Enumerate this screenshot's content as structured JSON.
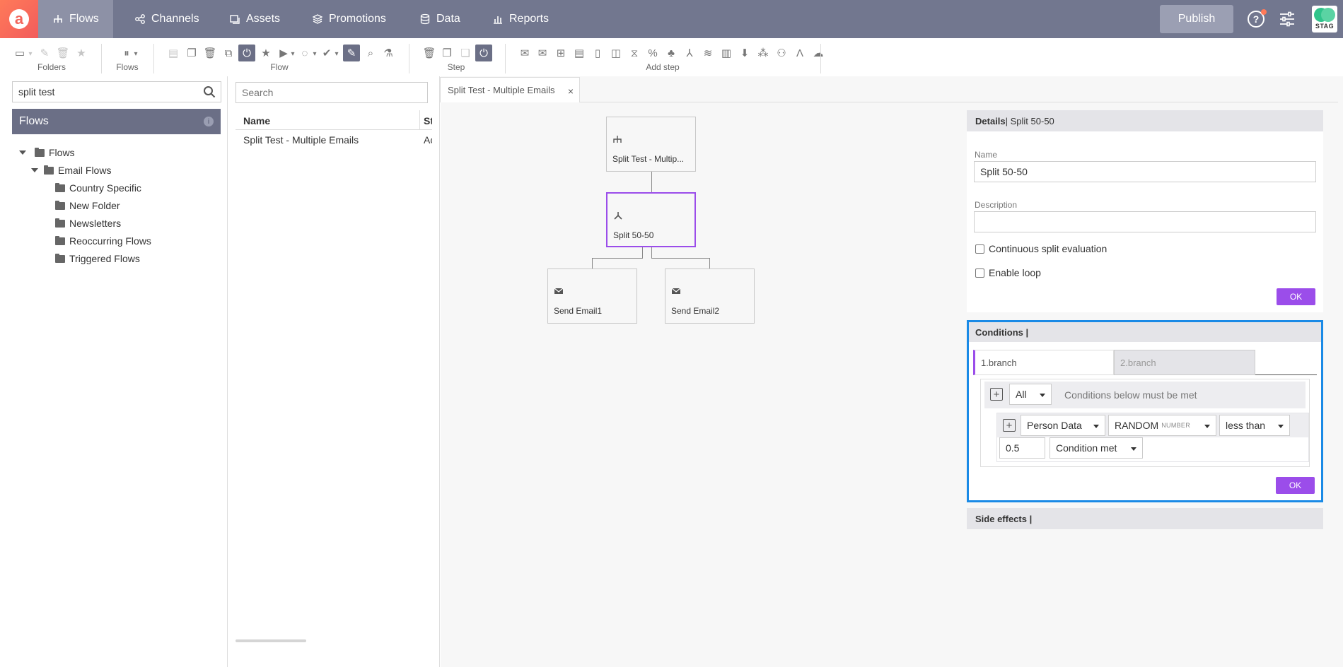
{
  "nav": {
    "logo": "a",
    "items": [
      {
        "label": "Flows",
        "icon": "flows-icon"
      },
      {
        "label": "Channels",
        "icon": "channels-icon"
      },
      {
        "label": "Assets",
        "icon": "assets-icon"
      },
      {
        "label": "Promotions",
        "icon": "promotions-icon"
      },
      {
        "label": "Data",
        "icon": "data-icon"
      },
      {
        "label": "Reports",
        "icon": "reports-icon"
      }
    ],
    "publish_label": "Publish",
    "help_label": "?",
    "env_label": "STAG"
  },
  "toolbar": {
    "groups": {
      "folders": "Folders",
      "flows": "Flows",
      "flow": "Flow",
      "step": "Step",
      "add_step": "Add step"
    }
  },
  "sidebar": {
    "search_value": "split test",
    "header": "Flows",
    "info": "i",
    "tree": [
      {
        "label": "Flows",
        "level": 0,
        "expanded": true
      },
      {
        "label": "Email Flows",
        "level": 1,
        "expanded": true
      },
      {
        "label": "Country Specific",
        "level": 2
      },
      {
        "label": "New Folder",
        "level": 2
      },
      {
        "label": "Newsletters",
        "level": 2
      },
      {
        "label": "Reoccurring Flows",
        "level": 2
      },
      {
        "label": "Triggered Flows",
        "level": 2
      }
    ]
  },
  "list": {
    "search_placeholder": "Search",
    "columns": [
      "Name",
      "Status"
    ],
    "rows": [
      {
        "name": "Split Test - Multiple Emails",
        "status": "Active"
      }
    ]
  },
  "canvas": {
    "tab_label": "Split Test - Multiple Emails",
    "tab_close": "×",
    "nodes": [
      {
        "label": "Split Test - Multip...",
        "icon": "flow-start-icon"
      },
      {
        "label": "Split 50-50",
        "icon": "split-icon",
        "selected": true
      },
      {
        "label": "Send Email1",
        "icon": "email-icon"
      },
      {
        "label": "Send Email2",
        "icon": "email-icon"
      }
    ]
  },
  "details": {
    "header_bold": "Details",
    "header_rest": " | Split 50-50",
    "name_label": "Name",
    "name_value": "Split 50-50",
    "description_label": "Description",
    "description_value": "",
    "continuous_label": "Continuous split evaluation",
    "continuous_checked": false,
    "loop_label": "Enable loop",
    "loop_checked": false,
    "ok_label": "OK"
  },
  "conditions": {
    "header": "Conditions |",
    "tabs": [
      "1.branch",
      "2.branch"
    ],
    "active_tab": "1.branch",
    "match_value": "All",
    "match_text": "Conditions below must be met",
    "rule": {
      "source": "Person Data",
      "field": "RANDOM",
      "field_type": "NUMBER",
      "operator": "less than",
      "value": "0.5",
      "result": "Condition met"
    },
    "ok_label": "OK"
  },
  "side_effects": {
    "header": "Side effects |"
  },
  "colors": {
    "topbar": "#72778f",
    "accent": "#9b4dea",
    "highlight": "#1a8ae6",
    "sidebar_header": "#6b6f86"
  }
}
